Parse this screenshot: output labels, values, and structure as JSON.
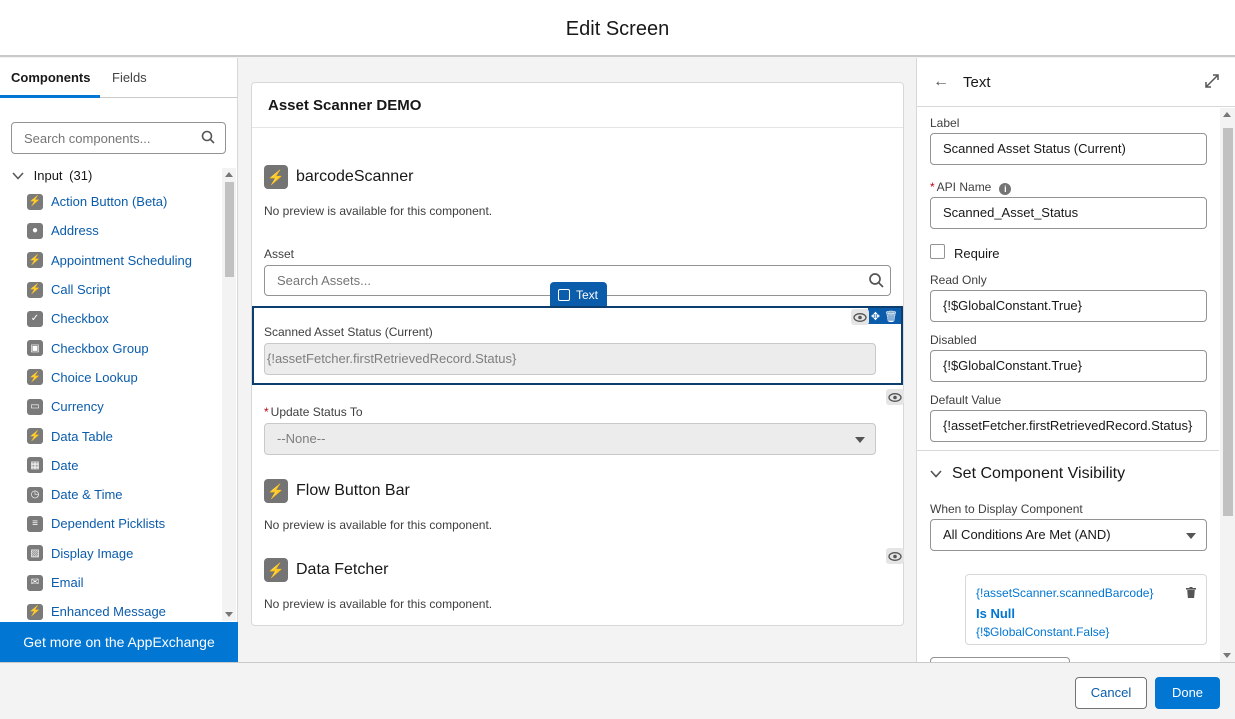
{
  "header": {
    "title": "Edit Screen"
  },
  "left_panel": {
    "tabs": [
      "Components",
      "Fields"
    ],
    "search_placeholder": "Search components...",
    "group": {
      "label": "Input",
      "count": "(31)"
    },
    "items": [
      {
        "label": "Action Button (Beta)",
        "icon": "lightning-icon"
      },
      {
        "label": "Address",
        "icon": "location-pin-icon"
      },
      {
        "label": "Appointment Scheduling",
        "icon": "lightning-icon"
      },
      {
        "label": "Call Script",
        "icon": "lightning-icon"
      },
      {
        "label": "Checkbox",
        "icon": "checkbox-icon"
      },
      {
        "label": "Checkbox Group",
        "icon": "checkbox-group-icon"
      },
      {
        "label": "Choice Lookup",
        "icon": "lightning-icon"
      },
      {
        "label": "Currency",
        "icon": "currency-icon"
      },
      {
        "label": "Data Table",
        "icon": "lightning-icon"
      },
      {
        "label": "Date",
        "icon": "calendar-icon"
      },
      {
        "label": "Date & Time",
        "icon": "calendar-clock-icon"
      },
      {
        "label": "Dependent Picklists",
        "icon": "list-icon"
      },
      {
        "label": "Display Image",
        "icon": "image-icon"
      },
      {
        "label": "Email",
        "icon": "email-icon"
      },
      {
        "label": "Enhanced Message",
        "icon": "lightning-icon"
      }
    ],
    "appexchange_label": "Get more on the AppExchange"
  },
  "canvas": {
    "title": "Asset Scanner DEMO",
    "barcode_scanner": {
      "name": "barcodeScanner",
      "note": "No preview is available for this component."
    },
    "asset": {
      "label": "Asset",
      "placeholder": "Search Assets..."
    },
    "selected_tag": "Text",
    "scanned_status": {
      "label": "Scanned Asset Status (Current)",
      "value": "{!assetFetcher.firstRetrievedRecord.Status}"
    },
    "update_status": {
      "required_marker": "*",
      "label": "Update Status To",
      "value": "--None--"
    },
    "flow_button_bar": {
      "name": "Flow Button Bar",
      "note": "No preview is available for this component."
    },
    "data_fetcher": {
      "name": "Data Fetcher",
      "note": "No preview is available for this component."
    }
  },
  "right_panel": {
    "title": "Text",
    "label_field": {
      "label": "Label",
      "value": "Scanned Asset Status (Current)"
    },
    "api_name": {
      "required_marker": "*",
      "label": "API Name",
      "value": "Scanned_Asset_Status"
    },
    "require_label": "Require",
    "read_only": {
      "label": "Read Only",
      "value": "{!$GlobalConstant.True}"
    },
    "disabled": {
      "label": "Disabled",
      "value": "{!$GlobalConstant.True}"
    },
    "default_value": {
      "label": "Default Value",
      "value": "{!assetFetcher.firstRetrievedRecord.Status}"
    },
    "visibility": {
      "heading": "Set Component Visibility",
      "when_label": "When to Display Component",
      "when_value": "All Conditions Are Met (AND)",
      "condition": {
        "resource": "{!assetScanner.scannedBarcode}",
        "operator": "Is Null",
        "value": "{!$GlobalConstant.False}"
      }
    }
  },
  "footer": {
    "cancel": "Cancel",
    "done": "Done"
  },
  "colors": {
    "brand": "#0176d3",
    "selection": "#0b5cab",
    "link": "#0b5cab"
  }
}
